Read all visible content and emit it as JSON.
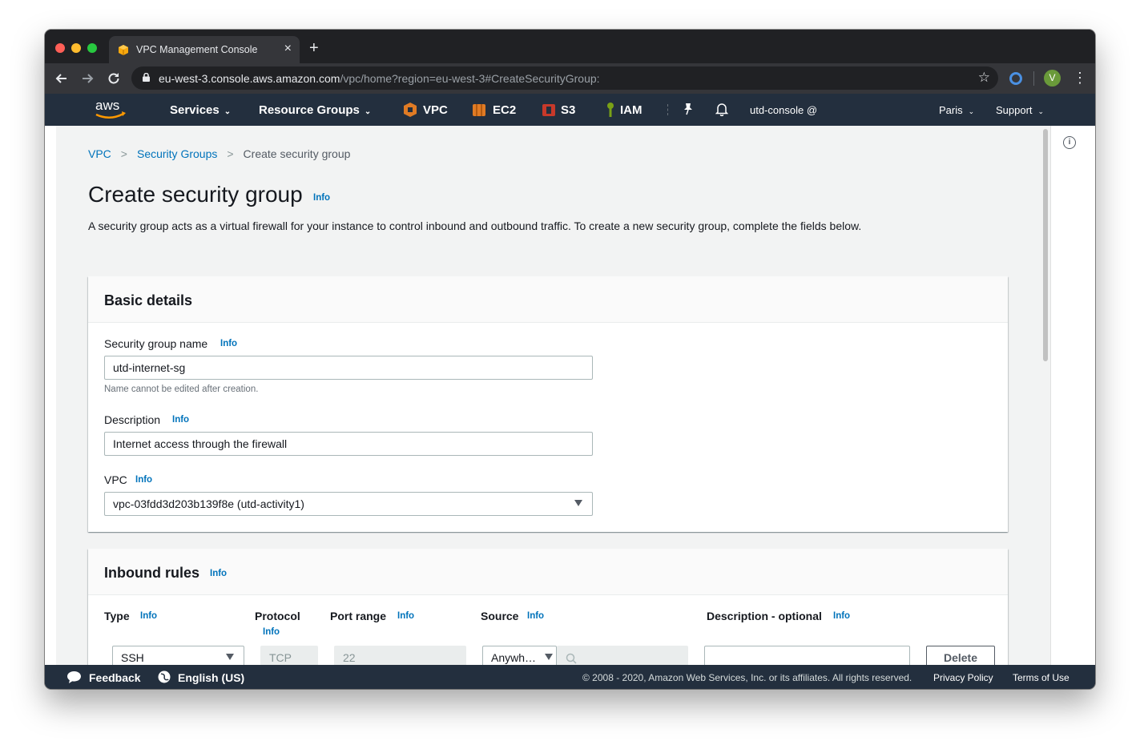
{
  "browser": {
    "tab_title": "VPC Management Console",
    "tab_close": "×",
    "new_tab": "+",
    "url_host": "eu-west-3.console.aws.amazon.com",
    "url_path": "/vpc/home?region=eu-west-3#CreateSecurityGroup:",
    "profile_initial": "V"
  },
  "aws_nav": {
    "logo_text": "aws",
    "services": "Services",
    "resource_groups": "Resource Groups",
    "shortcuts": [
      {
        "label": "VPC",
        "color": "#e07b24"
      },
      {
        "label": "EC2",
        "color": "#e07b24"
      },
      {
        "label": "S3",
        "color": "#c7392a"
      },
      {
        "label": "IAM",
        "color": "#7aa116"
      }
    ],
    "account": "utd-console @",
    "region": "Paris",
    "support": "Support"
  },
  "breadcrumb": {
    "items": [
      "VPC",
      "Security Groups"
    ],
    "current": "Create security group"
  },
  "page": {
    "title": "Create security group",
    "info": "Info",
    "description": "A security group acts as a virtual firewall for your instance to control inbound and outbound traffic. To create a new security group, complete the fields below."
  },
  "basic_details": {
    "title": "Basic details",
    "name_label": "Security group name",
    "name_value": "utd-internet-sg",
    "name_hint": "Name cannot be edited after creation.",
    "desc_label": "Description",
    "desc_value": "Internet access through the firewall",
    "vpc_label": "VPC",
    "vpc_value": "vpc-03fdd3d203b139f8e (utd-activity1)",
    "info": "Info"
  },
  "inbound_rules": {
    "title": "Inbound rules",
    "info": "Info",
    "columns": {
      "type": "Type",
      "protocol": "Protocol",
      "port_range": "Port range",
      "source": "Source",
      "description": "Description - optional"
    },
    "rows": [
      {
        "type": "SSH",
        "protocol": "TCP",
        "port_range": "22",
        "source": "Anywh…",
        "source_cidr": "",
        "description": "",
        "delete_label": "Delete"
      }
    ]
  },
  "footer": {
    "feedback": "Feedback",
    "language": "English (US)",
    "copyright": "© 2008 - 2020, Amazon Web Services, Inc. or its affiliates. All rights reserved.",
    "privacy": "Privacy Policy",
    "terms": "Terms of Use"
  },
  "colors": {
    "aws_nav_bg": "#232f3e",
    "link_blue": "#0073bb",
    "page_bg": "#f2f3f3"
  }
}
